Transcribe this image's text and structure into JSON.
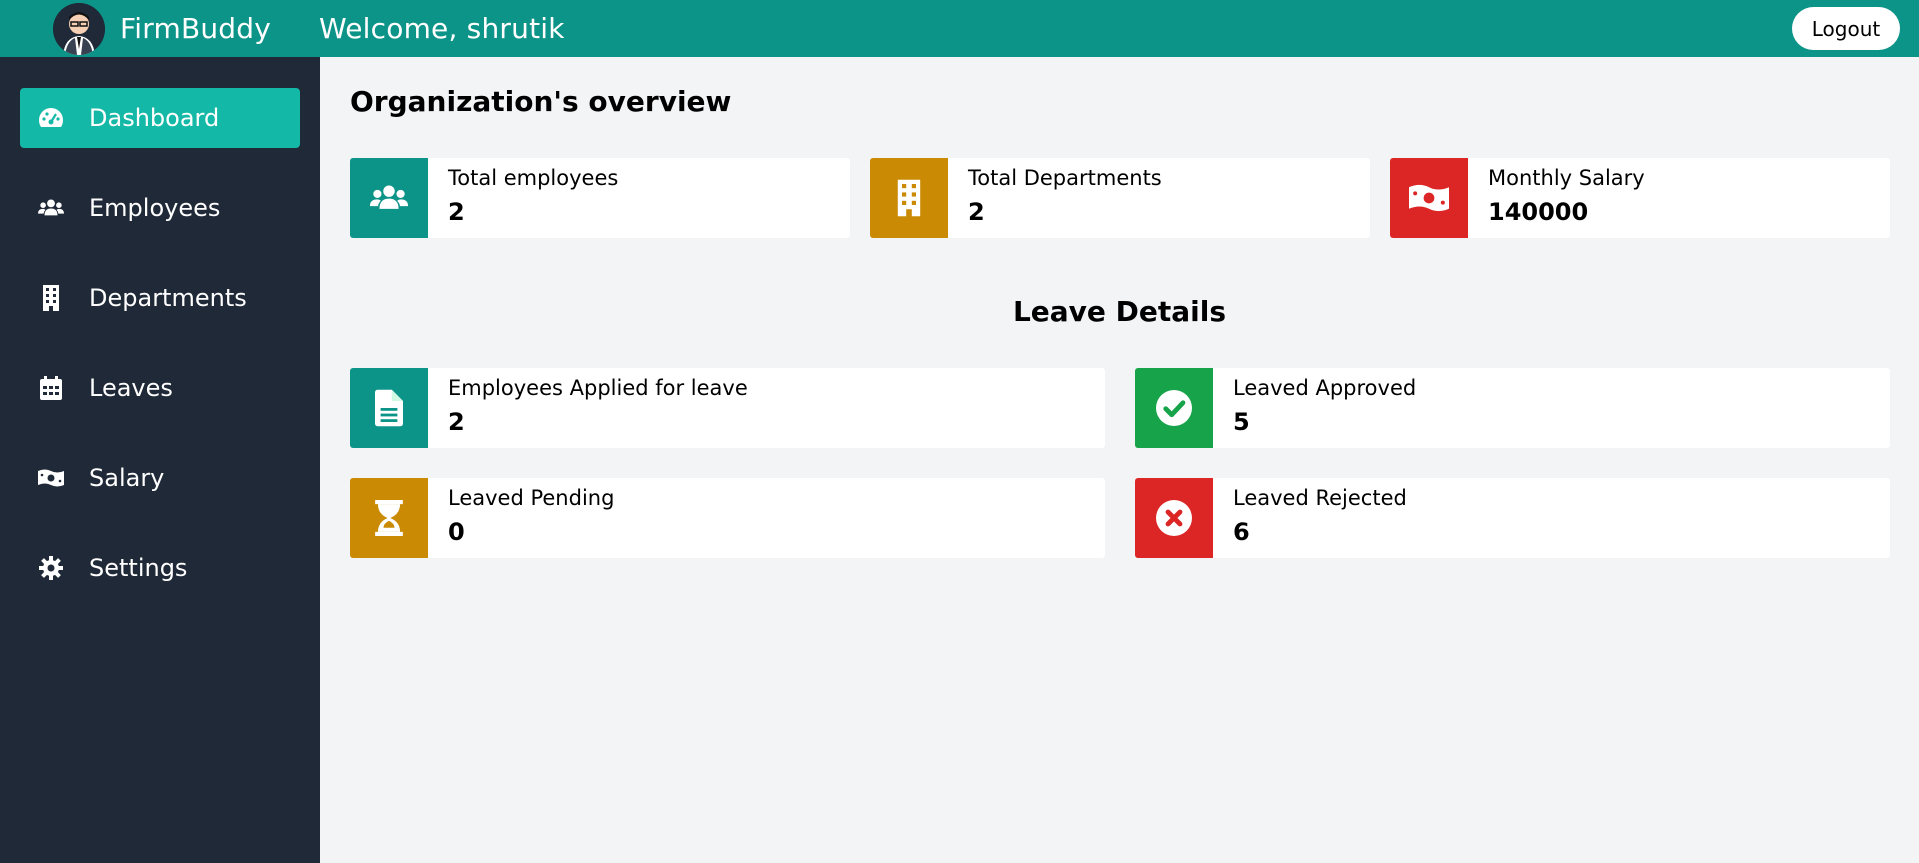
{
  "header": {
    "brand": "FirmBuddy",
    "welcome": "Welcome, shrutik",
    "logout_label": "Logout",
    "colors": {
      "bar": "#0d9488"
    }
  },
  "sidebar": {
    "items": [
      {
        "label": "Dashboard",
        "icon": "gauge-icon",
        "active": true
      },
      {
        "label": "Employees",
        "icon": "users-icon"
      },
      {
        "label": "Departments",
        "icon": "building-icon"
      },
      {
        "label": "Leaves",
        "icon": "calendar-icon"
      },
      {
        "label": "Salary",
        "icon": "money-bill-icon"
      },
      {
        "label": "Settings",
        "icon": "gear-icon"
      }
    ],
    "colors": {
      "bg": "#1f2937",
      "active": "#14b8a6"
    }
  },
  "main": {
    "title": "Organization's overview",
    "overview": [
      {
        "label": "Total employees",
        "value": "2",
        "icon": "users-icon",
        "color": "#0d9488"
      },
      {
        "label": "Total Departments",
        "value": "2",
        "icon": "building-icon",
        "color": "#ca8a04"
      },
      {
        "label": "Monthly Salary",
        "value": "140000",
        "icon": "money-bill-icon",
        "color": "#dc2626"
      }
    ],
    "leave_title": "Leave Details",
    "leaves": [
      {
        "label": "Employees Applied for leave",
        "value": "2",
        "icon": "file-icon",
        "color": "#0d9488"
      },
      {
        "label": "Leaved Approved",
        "value": "5",
        "icon": "check-circle-icon",
        "color": "#16a34a"
      },
      {
        "label": "Leaved Pending",
        "value": "0",
        "icon": "hourglass-icon",
        "color": "#ca8a04"
      },
      {
        "label": "Leaved Rejected",
        "value": "6",
        "icon": "times-circle-icon",
        "color": "#dc2626"
      }
    ]
  }
}
